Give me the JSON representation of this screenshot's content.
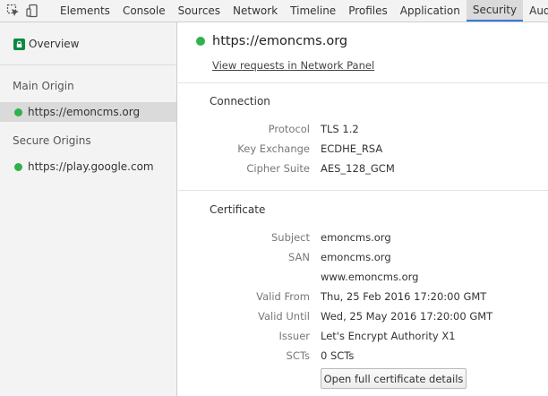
{
  "toolbar": {
    "tabs": [
      {
        "label": "Elements"
      },
      {
        "label": "Console"
      },
      {
        "label": "Sources"
      },
      {
        "label": "Network"
      },
      {
        "label": "Timeline"
      },
      {
        "label": "Profiles"
      },
      {
        "label": "Application"
      },
      {
        "label": "Security",
        "active": true
      },
      {
        "label": "Audits"
      }
    ]
  },
  "sidebar": {
    "overview": "Overview",
    "main_origin_heading": "Main Origin",
    "main_origin": "https://emoncms.org",
    "secure_origins_heading": "Secure Origins",
    "secure_origin": "https://play.google.com"
  },
  "main": {
    "origin": "https://emoncms.org",
    "view_requests": "View requests in Network Panel",
    "connection": {
      "title": "Connection",
      "protocol_label": "Protocol",
      "protocol": "TLS 1.2",
      "kex_label": "Key Exchange",
      "kex": "ECDHE_RSA",
      "cipher_label": "Cipher Suite",
      "cipher": "AES_128_GCM"
    },
    "certificate": {
      "title": "Certificate",
      "subject_label": "Subject",
      "subject": "emoncms.org",
      "san_label": "SAN",
      "san1": "emoncms.org",
      "san2": "www.emoncms.org",
      "valid_from_label": "Valid From",
      "valid_from": "Thu, 25 Feb 2016 17:20:00 GMT",
      "valid_until_label": "Valid Until",
      "valid_until": "Wed, 25 May 2016 17:20:00 GMT",
      "issuer_label": "Issuer",
      "issuer": "Let's Encrypt Authority X1",
      "scts_label": "SCTs",
      "scts": "0 SCTs",
      "details_button": "Open full certificate details"
    }
  },
  "colors": {
    "secure_green": "#2fb24c",
    "active_tab_accent": "#3879d9"
  },
  "icons": [
    "inspect-element-icon",
    "device-mode-icon",
    "lock-icon"
  ]
}
